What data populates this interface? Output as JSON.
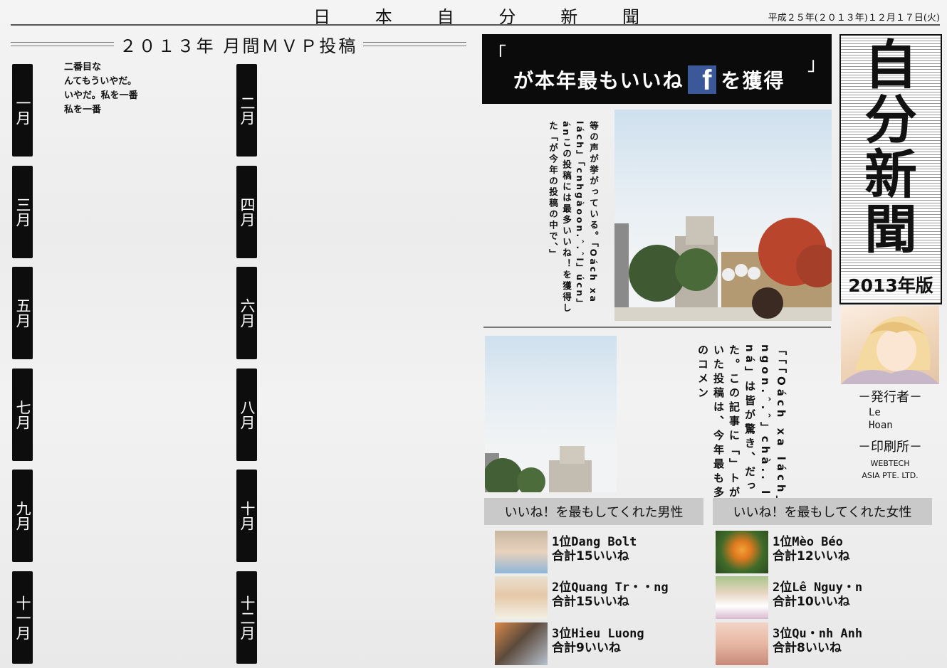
{
  "header": {
    "masthead_chars": [
      "日",
      "本",
      "自",
      "分",
      "新",
      "聞"
    ],
    "date": "平成２５年(２０１３年)１２月１７日(火)"
  },
  "mvp": {
    "title": "２０１３年 月間ＭＶＰ投稿",
    "months": [
      "一月",
      "二月",
      "三月",
      "四月",
      "五月",
      "六月",
      "七月",
      "八月",
      "九月",
      "十月",
      "十一月",
      "十二月"
    ],
    "january_lines": [
      "二番目な",
      "んてもういやだ。",
      "いやだ。私を一番",
      "私を一番"
    ]
  },
  "banner": {
    "open_quote": "「",
    "close_quote": "」",
    "before_icon": "が本年最もいいね",
    "icon_name": "facebook-icon",
    "icon_letter": "f",
    "after_icon": "を獲得",
    "brand_color": "#3b5998"
  },
  "article1": {
    "text": "等の声が挙がっている。「Oách xa lách」「cnhgàoon.ˆ.ˆl」úcn」 ánこの投稿には最多いいね！を獲得した「が今年の投稿の中で、」"
  },
  "article2": {
    "text": "「「「Oách xa lách」ngon.ˆ.ˆ」chà.. lúc ná」は皆が驚き、だった。この記事に「」トがついた投稿は、今年最も多くのコメン"
  },
  "sidebar": {
    "logo": "自分新聞",
    "edition": "2013年版",
    "publisher_label": "－発行者－",
    "publisher_lines": [
      "Le",
      "Hoan"
    ],
    "printer_label": "－印刷所－",
    "printer_lines": [
      "WEBTECH",
      "ASIA PTE. LTD."
    ]
  },
  "ranking": {
    "male": {
      "heading": "いいね！を最もしてくれた男性",
      "items": [
        {
          "name": "1位Dang Bolt",
          "total": "合計15いいね"
        },
        {
          "name": "2位Quang Tr・・ng",
          "total": "合計15いいね"
        },
        {
          "name": "3位Hieu Luong",
          "total": "合計9いいね"
        }
      ]
    },
    "female": {
      "heading": "いいね！を最もしてくれた女性",
      "items": [
        {
          "name": "1位Mèo Béo",
          "total": "合計12いいね"
        },
        {
          "name": "2位Lê Nguy・n",
          "total": "合計10いいね"
        },
        {
          "name": "3位Qu・nh Anh",
          "total": "合計8いいね"
        }
      ]
    }
  }
}
